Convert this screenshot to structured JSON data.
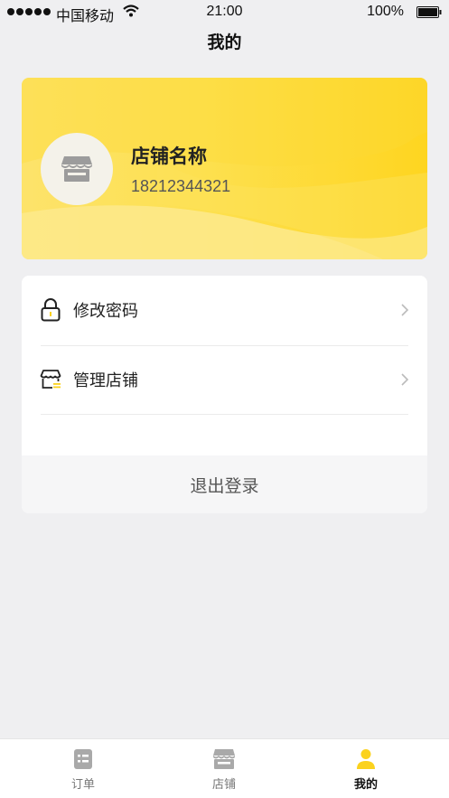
{
  "status_bar": {
    "carrier": "中国移动",
    "time": "21:00",
    "battery": "100%"
  },
  "nav": {
    "title": "我的"
  },
  "profile": {
    "store_name": "店铺名称",
    "phone": "18212344321",
    "avatar_icon": "storefront-icon"
  },
  "menu": {
    "items": [
      {
        "label": "修改密码",
        "icon": "lock-icon"
      },
      {
        "label": "管理店铺",
        "icon": "store-manage-icon"
      }
    ],
    "logout_label": "退出登录"
  },
  "tab_bar": {
    "tabs": [
      {
        "label": "订单",
        "icon": "order-list-icon",
        "active": false
      },
      {
        "label": "店铺",
        "icon": "store-icon",
        "active": false
      },
      {
        "label": "我的",
        "icon": "user-icon",
        "active": true
      }
    ]
  },
  "colors": {
    "accent": "#fbd21e",
    "background": "#efeff1"
  }
}
